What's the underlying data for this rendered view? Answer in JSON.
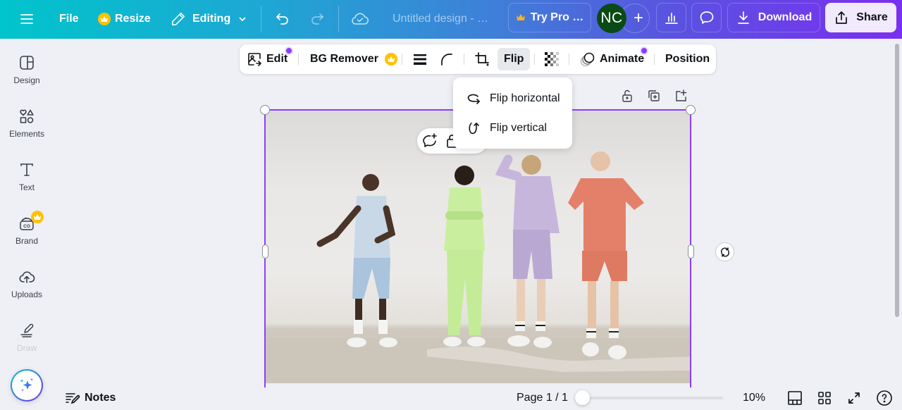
{
  "topbar": {
    "file": "File",
    "resize": "Resize",
    "mode": "Editing",
    "title": "Untitled design -  …",
    "try_pro": "Try Pro …",
    "avatar_initials": "NC",
    "download": "Download",
    "share": "Share"
  },
  "sidebar": {
    "items": [
      {
        "label": "Design",
        "icon": "design-icon"
      },
      {
        "label": "Elements",
        "icon": "elements-icon"
      },
      {
        "label": "Text",
        "icon": "text-icon"
      },
      {
        "label": "Brand",
        "icon": "brand-icon",
        "pro": true
      },
      {
        "label": "Uploads",
        "icon": "uploads-icon"
      },
      {
        "label": "Draw",
        "icon": "draw-icon"
      }
    ]
  },
  "context_toolbar": {
    "edit": "Edit",
    "bg_remover": "BG Remover",
    "flip": "Flip",
    "animate": "Animate",
    "position": "Position"
  },
  "flip_menu": {
    "items": [
      {
        "label": "Flip horizontal",
        "icon": "flip-horizontal-icon"
      },
      {
        "label": "Flip vertical",
        "icon": "flip-vertical-icon"
      }
    ]
  },
  "canvas": {
    "image_description": "Four models in pastel loungewear (light blue, mint green, lavender, coral) standing against a white wall on a concrete floor"
  },
  "bottombar": {
    "notes": "Notes",
    "page": "Page 1 / 1",
    "zoom_percent": "10%",
    "zoom_slider_fraction": 0.0
  },
  "colors": {
    "accent": "#8b3dff",
    "pro_crown": "#ffc107",
    "avatar_bg": "#0a4a14"
  }
}
